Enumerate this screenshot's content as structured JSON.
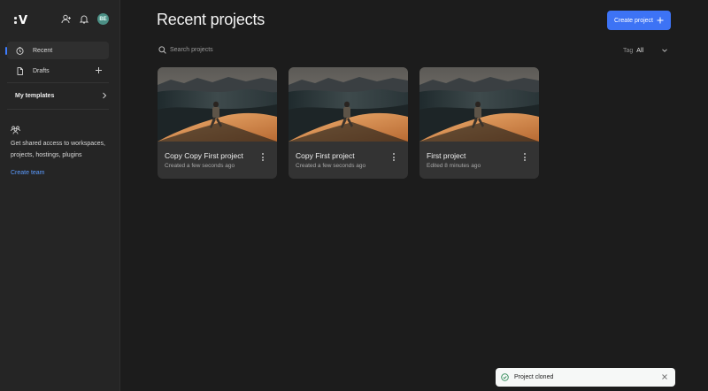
{
  "sidebar": {
    "avatar_initials": "BE",
    "nav": [
      {
        "label": "Recent",
        "icon": "clock-icon",
        "active": true
      },
      {
        "label": "Drafts",
        "icon": "document-icon",
        "active": false
      }
    ],
    "templates_label": "My templates",
    "team_promo_text": "Get shared access to workspaces, projects, hostings, plugins",
    "create_team_label": "Create team"
  },
  "main": {
    "title": "Recent projects",
    "create_button_label": "Create project",
    "search_placeholder": "Search projects",
    "tag_label": "Tag",
    "tag_value": "All",
    "projects": [
      {
        "title": "Copy Copy First project",
        "subtitle": "Created a few seconds ago"
      },
      {
        "title": "Copy First project",
        "subtitle": "Created a few seconds ago"
      },
      {
        "title": "First project",
        "subtitle": "Edited 8 minutes ago"
      }
    ]
  },
  "toast": {
    "message": "Project cloned"
  },
  "colors": {
    "accent": "#3d73f5",
    "link": "#5b9bff",
    "avatar": "#4b8f85"
  }
}
